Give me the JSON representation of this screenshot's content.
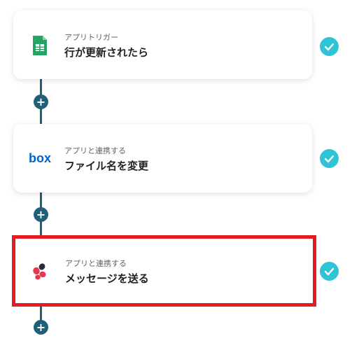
{
  "flow": {
    "steps": [
      {
        "subtitle": "アプリトリガー",
        "title": "行が更新されたら",
        "icon": "google-sheets-icon",
        "status": "completed",
        "selected": false
      },
      {
        "subtitle": "アプリと連携する",
        "title": "ファイル名を変更",
        "icon": "box-logo-icon",
        "status": "completed",
        "selected": false
      },
      {
        "subtitle": "アプリと連携する",
        "title": "メッセージを送る",
        "icon": "chatwork-icon",
        "status": "completed",
        "selected": true
      }
    ],
    "add_button_label": "+",
    "box_logo_text": "box"
  },
  "colors": {
    "connector": "#1f5f7a",
    "check": "#2ec4d6",
    "selected_border": "#e31b23",
    "sheets_green": "#23a566",
    "box_blue": "#0061d5"
  }
}
